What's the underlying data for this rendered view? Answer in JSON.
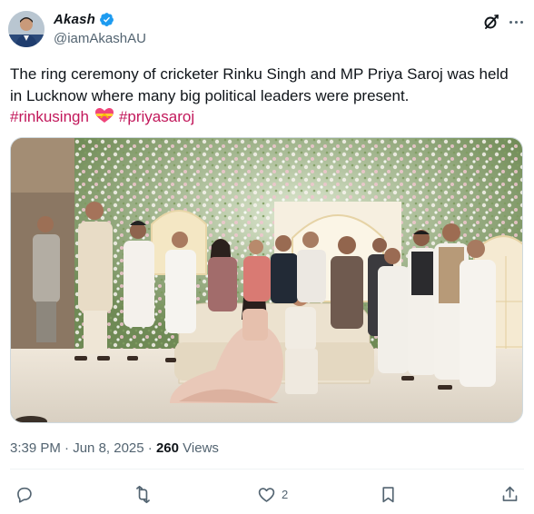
{
  "author": {
    "display_name": "Akash",
    "handle": "@iamAkashAU",
    "verified": true,
    "avatar_icon": "profile-photo"
  },
  "tweet": {
    "text_line1": "The ring ceremony of cricketer Rinku Singh and MP Priya Saroj was held",
    "text_line2": "in Lucknow where many big political leaders were present.",
    "hashtag1": "#rinkusingh",
    "emoji": "heart-with-ribbon",
    "hashtag2": "#priyasaroj"
  },
  "media": {
    "type": "photo",
    "description_icon": "group-photo"
  },
  "meta": {
    "time": "3:39 PM",
    "separator": "·",
    "date": "Jun 8, 2025",
    "views_count": "260",
    "views_label": "Views"
  },
  "actions": {
    "reply_count": "",
    "repost_count": "",
    "like_count": "2",
    "bookmark_count": ""
  },
  "colors": {
    "text": "#0f1419",
    "secondary": "#536471",
    "hashtag": "#c2185b",
    "verified": "#1d9bf0",
    "divider": "#eff3f4"
  }
}
